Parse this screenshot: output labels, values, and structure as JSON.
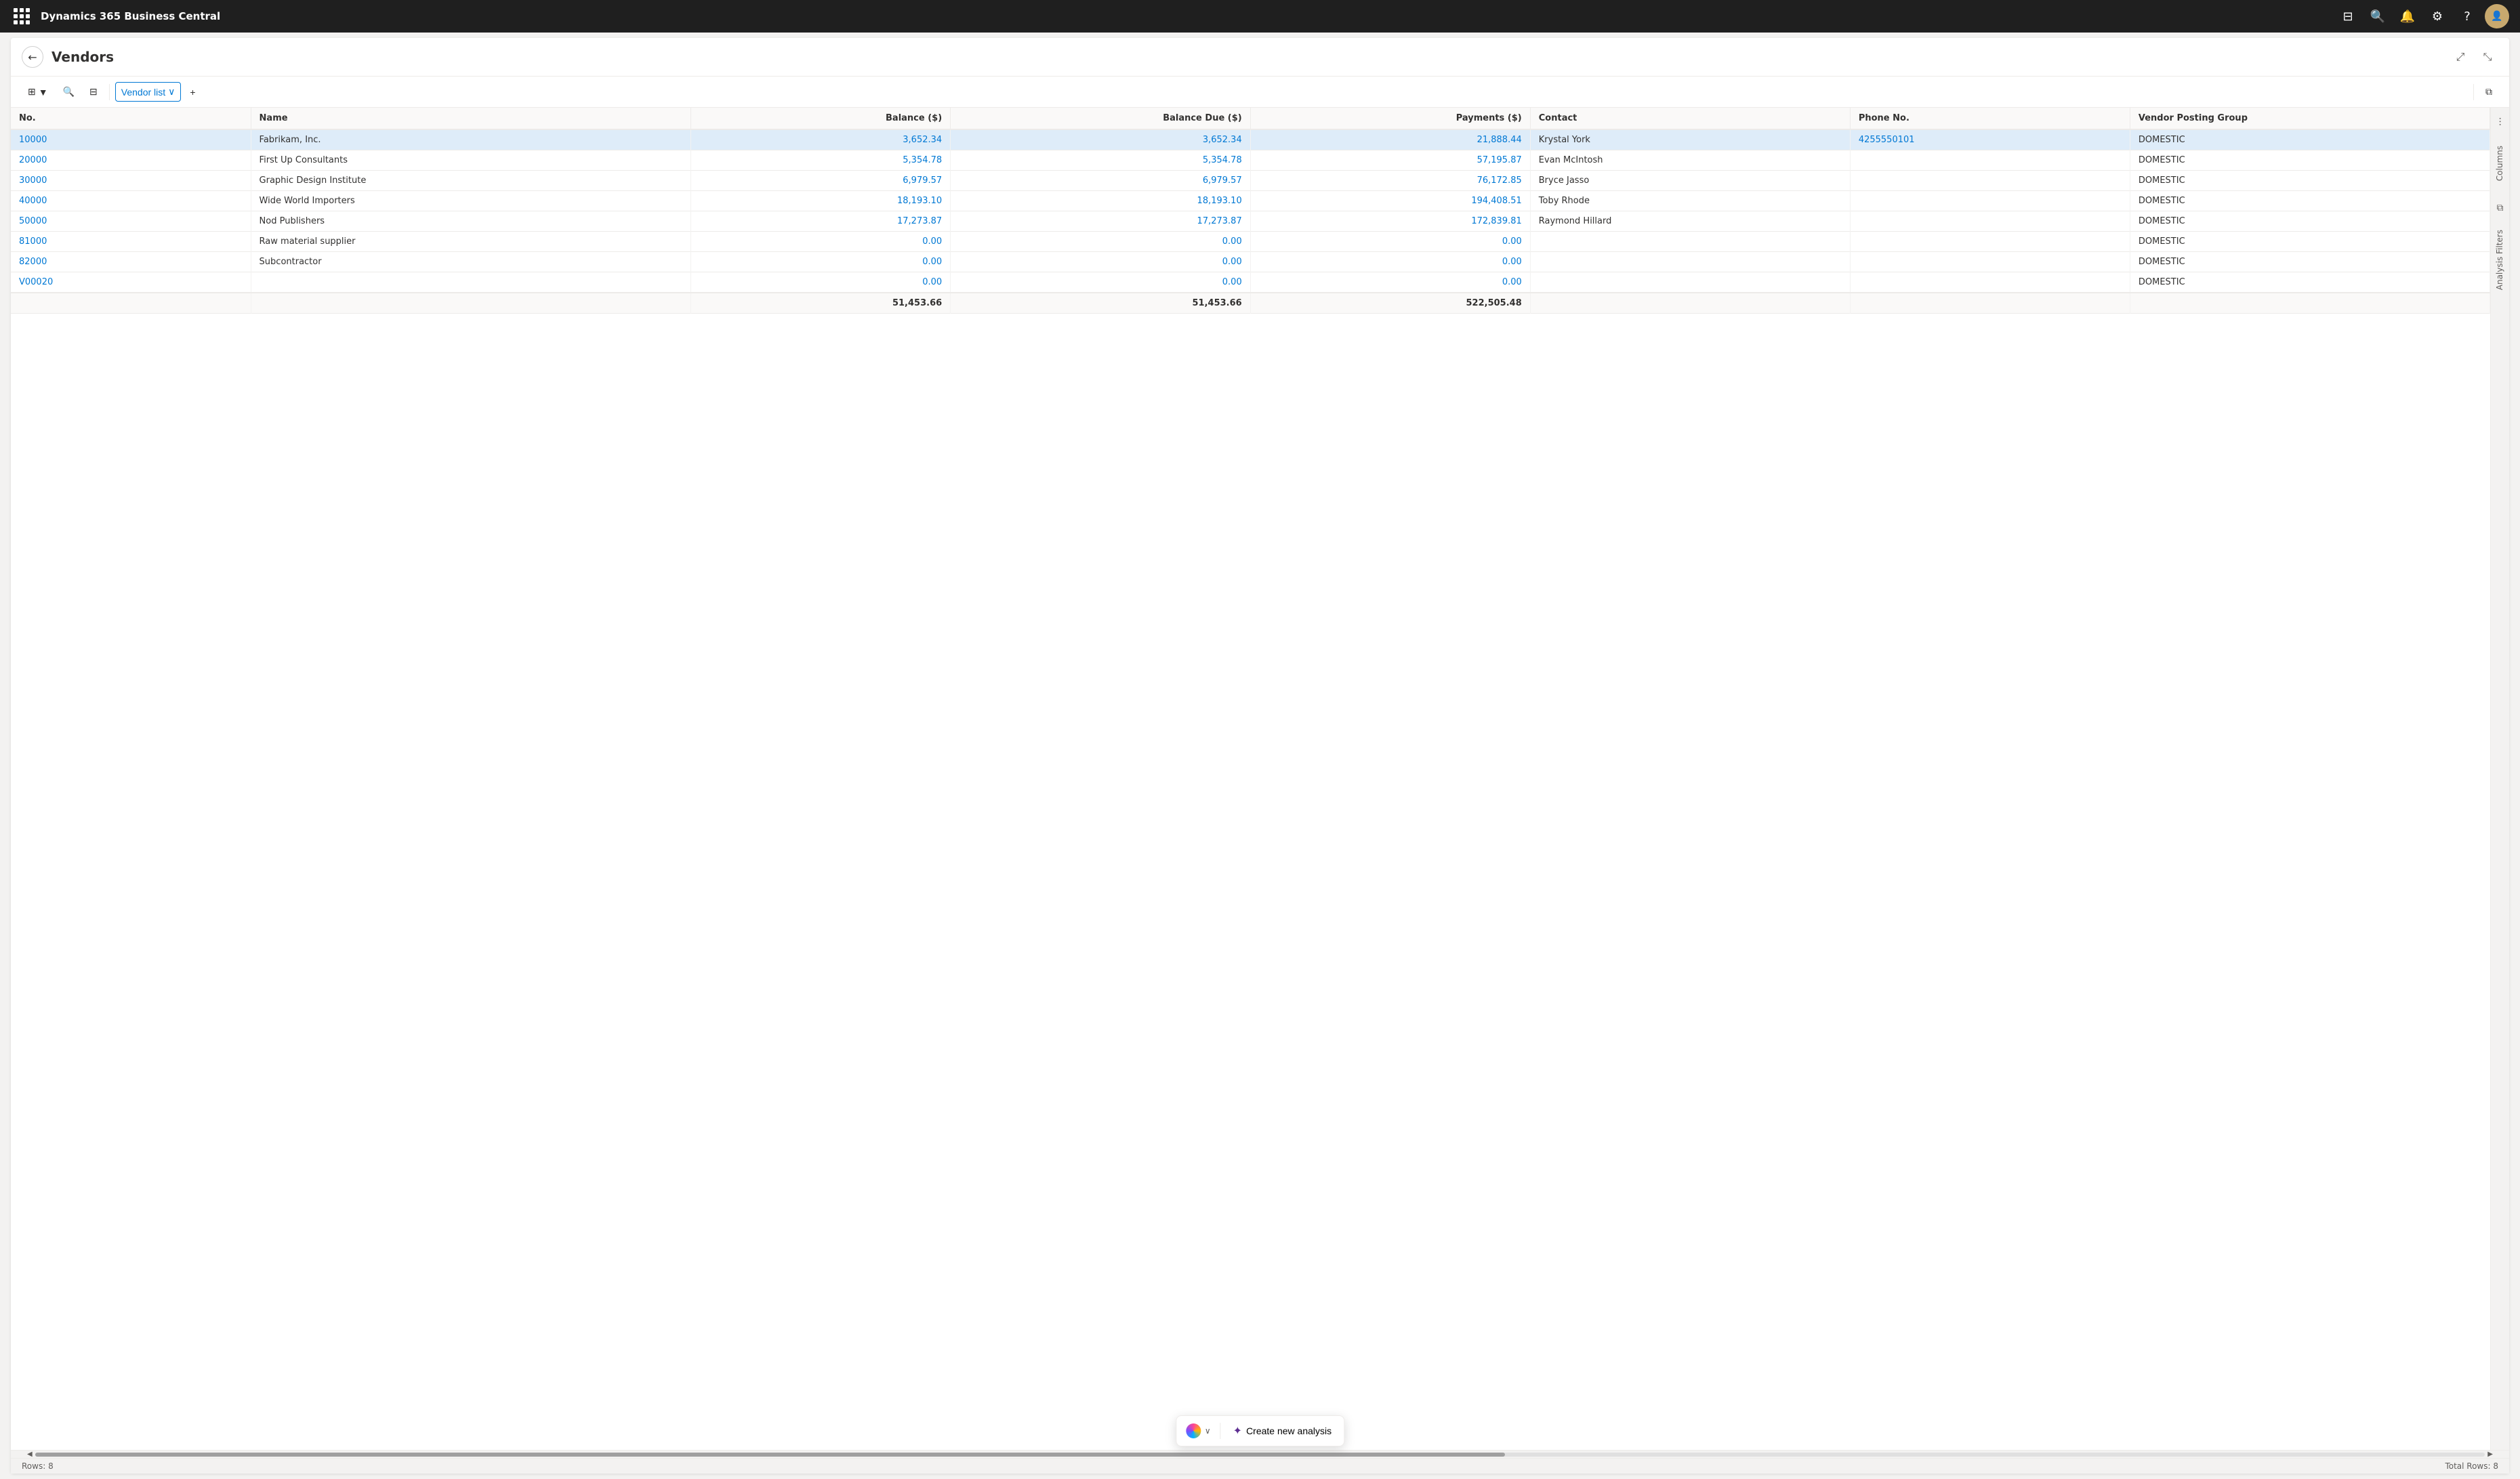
{
  "app": {
    "title": "Dynamics 365 Business Central"
  },
  "page": {
    "title": "Vendors",
    "back_label": "←"
  },
  "toolbar": {
    "view_label": "Vendor list",
    "add_label": "+",
    "filter_label": "⧉"
  },
  "table": {
    "columns": [
      {
        "id": "no",
        "label": "No.",
        "numeric": false
      },
      {
        "id": "name",
        "label": "Name",
        "numeric": false
      },
      {
        "id": "balance",
        "label": "Balance ($)",
        "numeric": true
      },
      {
        "id": "balance_due",
        "label": "Balance Due ($)",
        "numeric": true
      },
      {
        "id": "payments",
        "label": "Payments ($)",
        "numeric": true
      },
      {
        "id": "contact",
        "label": "Contact",
        "numeric": false
      },
      {
        "id": "phone",
        "label": "Phone No.",
        "numeric": false
      },
      {
        "id": "posting_group",
        "label": "Vendor Posting Group",
        "numeric": false
      }
    ],
    "rows": [
      {
        "no": "10000",
        "name": "Fabrikam, Inc.",
        "balance": "3,652.34",
        "balance_due": "3,652.34",
        "payments": "21,888.44",
        "contact": "Krystal York",
        "phone": "4255550101",
        "posting_group": "DOMESTIC",
        "selected": true
      },
      {
        "no": "20000",
        "name": "First Up Consultants",
        "balance": "5,354.78",
        "balance_due": "5,354.78",
        "payments": "57,195.87",
        "contact": "Evan McIntosh",
        "phone": "",
        "posting_group": "DOMESTIC",
        "selected": false
      },
      {
        "no": "30000",
        "name": "Graphic Design Institute",
        "balance": "6,979.57",
        "balance_due": "6,979.57",
        "payments": "76,172.85",
        "contact": "Bryce Jasso",
        "phone": "",
        "posting_group": "DOMESTIC",
        "selected": false
      },
      {
        "no": "40000",
        "name": "Wide World Importers",
        "balance": "18,193.10",
        "balance_due": "18,193.10",
        "payments": "194,408.51",
        "contact": "Toby Rhode",
        "phone": "",
        "posting_group": "DOMESTIC",
        "selected": false
      },
      {
        "no": "50000",
        "name": "Nod Publishers",
        "balance": "17,273.87",
        "balance_due": "17,273.87",
        "payments": "172,839.81",
        "contact": "Raymond Hillard",
        "phone": "",
        "posting_group": "DOMESTIC",
        "selected": false
      },
      {
        "no": "81000",
        "name": "Raw material supplier",
        "balance": "0.00",
        "balance_due": "0.00",
        "payments": "0.00",
        "contact": "",
        "phone": "",
        "posting_group": "DOMESTIC",
        "selected": false
      },
      {
        "no": "82000",
        "name": "Subcontractor",
        "balance": "0.00",
        "balance_due": "0.00",
        "payments": "0.00",
        "contact": "",
        "phone": "",
        "posting_group": "DOMESTIC",
        "selected": false
      },
      {
        "no": "V00020",
        "name": "",
        "balance": "0.00",
        "balance_due": "0.00",
        "payments": "0.00",
        "contact": "",
        "phone": "",
        "posting_group": "DOMESTIC",
        "selected": false
      }
    ],
    "totals": {
      "balance": "51,453.66",
      "balance_due": "51,453.66",
      "payments": "522,505.48"
    }
  },
  "sidebar": {
    "columns_label": "Columns",
    "filters_label": "Analysis Filters"
  },
  "status": {
    "rows_label": "Rows: 8",
    "total_rows_label": "Total Rows: 8"
  },
  "floating": {
    "copilot_label": "",
    "new_analysis_label": "Create new analysis",
    "new_analysis_icon": "✦"
  },
  "icons": {
    "waffle": "⊞",
    "search": "🔍",
    "bell": "🔔",
    "settings": "⚙",
    "help": "?",
    "expand": "⤢",
    "collapse": "⤡",
    "back": "←",
    "chevron_down": "∨",
    "columns_icon": "⫶",
    "filter_icon": "⧉"
  }
}
